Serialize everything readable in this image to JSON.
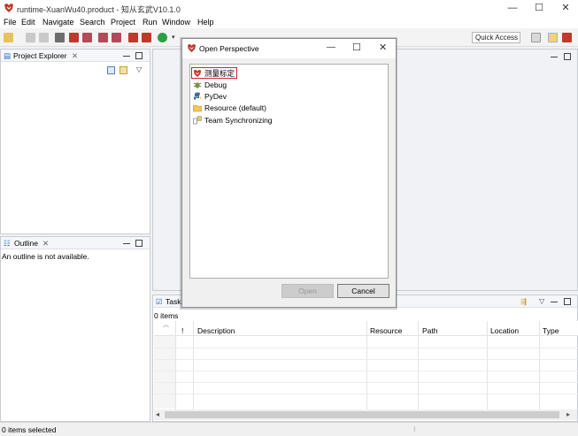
{
  "window": {
    "title": "runtime-XuanWu40.product - 知从玄武V10.1.0",
    "min": "—",
    "max": "☐",
    "close": "✕"
  },
  "menu": [
    "File",
    "Edit",
    "Navigate",
    "Search",
    "Project",
    "Run",
    "Window",
    "Help"
  ],
  "toolbar": {
    "quick_access": "Quick Access"
  },
  "project_explorer": {
    "tab": "Project Explorer",
    "close": "✕"
  },
  "outline": {
    "tab": "Outline",
    "close": "✕",
    "message": "An outline is not available."
  },
  "tasks": {
    "tab": "Tasks",
    "count": "0 items",
    "columns": [
      "!",
      "Description",
      "Resource",
      "Path",
      "Location",
      "Type"
    ]
  },
  "status_bar": {
    "text": "0 items selected"
  },
  "dialog": {
    "title": "Open Perspective",
    "min": "—",
    "max": "☐",
    "close": "✕",
    "perspectives": [
      {
        "label": "测量标定",
        "icon": "app-logo-icon",
        "selected": true
      },
      {
        "label": "Debug",
        "icon": "bug-icon",
        "selected": false
      },
      {
        "label": "PyDev",
        "icon": "python-icon",
        "selected": false
      },
      {
        "label": "Resource (default)",
        "icon": "folder-icon",
        "selected": false
      },
      {
        "label": "Team Synchronizing",
        "icon": "sync-icon",
        "selected": false
      }
    ],
    "open_label": "Open",
    "cancel_label": "Cancel"
  },
  "colors": {
    "selection_border": "#d11f2a",
    "workbench_bg": "#f0f2f5",
    "scrollbar": "#cdcdcd"
  }
}
